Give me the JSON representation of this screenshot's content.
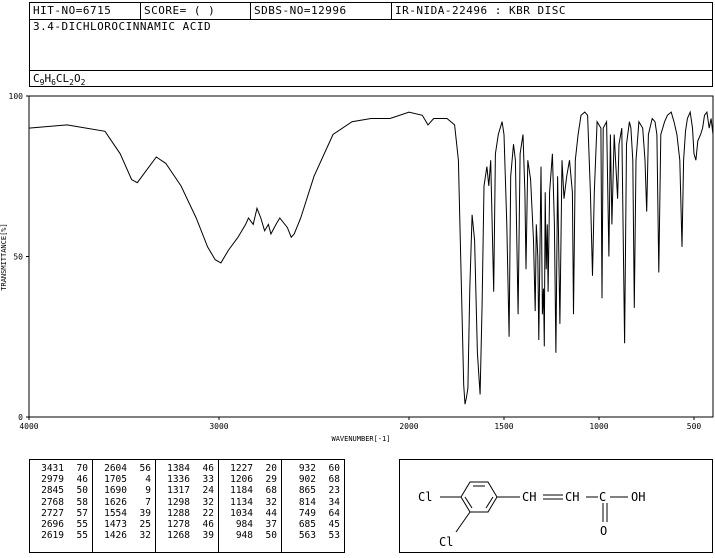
{
  "header": {
    "hit_no": "HIT-NO=6715",
    "score": "SCORE=  (   )",
    "sdbs_no": "SDBS-NO=12996",
    "ir_method": "IR-NIDA-22496 : KBR DISC",
    "compound_name": "3.4-DICHLOROCINNAMIC ACID",
    "formula_parts": [
      "C",
      "9",
      "H",
      "6",
      "CL",
      "2",
      "O",
      "2"
    ]
  },
  "chart_data": {
    "type": "line",
    "title": "",
    "xlabel": "WAVENUMBER[-1]",
    "ylabel": "TRANSMITTANCE[%]",
    "xlim": [
      4000,
      400
    ],
    "ylim": [
      0,
      100
    ],
    "x_reversed": true,
    "x_ticks": [
      "4000",
      "3000",
      "2000",
      "1500",
      "1000",
      "500"
    ],
    "y_ticks": [
      "0",
      "50",
      "100"
    ],
    "grid": false,
    "series": [
      {
        "color": "#000000",
        "points": [
          [
            4000,
            90
          ],
          [
            3800,
            91
          ],
          [
            3600,
            89
          ],
          [
            3520,
            82
          ],
          [
            3460,
            74
          ],
          [
            3430,
            73
          ],
          [
            3380,
            77
          ],
          [
            3330,
            81
          ],
          [
            3280,
            79
          ],
          [
            3200,
            72
          ],
          [
            3120,
            62
          ],
          [
            3060,
            53
          ],
          [
            3020,
            49
          ],
          [
            2990,
            48
          ],
          [
            2950,
            52
          ],
          [
            2900,
            56
          ],
          [
            2860,
            60
          ],
          [
            2845,
            62
          ],
          [
            2820,
            60
          ],
          [
            2800,
            65
          ],
          [
            2780,
            62
          ],
          [
            2760,
            58
          ],
          [
            2740,
            60
          ],
          [
            2727,
            57
          ],
          [
            2700,
            60
          ],
          [
            2680,
            62
          ],
          [
            2640,
            59
          ],
          [
            2620,
            56
          ],
          [
            2604,
            57
          ],
          [
            2570,
            62
          ],
          [
            2500,
            75
          ],
          [
            2400,
            88
          ],
          [
            2300,
            92
          ],
          [
            2200,
            93
          ],
          [
            2100,
            93
          ],
          [
            2000,
            95
          ],
          [
            1930,
            94
          ],
          [
            1900,
            91
          ],
          [
            1870,
            93
          ],
          [
            1800,
            93
          ],
          [
            1760,
            91
          ],
          [
            1740,
            80
          ],
          [
            1720,
            30
          ],
          [
            1712,
            10
          ],
          [
            1705,
            4
          ],
          [
            1698,
            6
          ],
          [
            1690,
            9
          ],
          [
            1680,
            40
          ],
          [
            1668,
            63
          ],
          [
            1655,
            55
          ],
          [
            1640,
            20
          ],
          [
            1626,
            7
          ],
          [
            1615,
            35
          ],
          [
            1605,
            72
          ],
          [
            1590,
            78
          ],
          [
            1580,
            72
          ],
          [
            1570,
            80
          ],
          [
            1554,
            39
          ],
          [
            1545,
            82
          ],
          [
            1530,
            88
          ],
          [
            1510,
            92
          ],
          [
            1500,
            88
          ],
          [
            1485,
            60
          ],
          [
            1473,
            25
          ],
          [
            1465,
            75
          ],
          [
            1450,
            85
          ],
          [
            1440,
            80
          ],
          [
            1426,
            32
          ],
          [
            1415,
            82
          ],
          [
            1400,
            88
          ],
          [
            1390,
            70
          ],
          [
            1384,
            46
          ],
          [
            1375,
            80
          ],
          [
            1360,
            74
          ],
          [
            1345,
            55
          ],
          [
            1336,
            33
          ],
          [
            1330,
            60
          ],
          [
            1322,
            50
          ],
          [
            1317,
            24
          ],
          [
            1305,
            78
          ],
          [
            1298,
            32
          ],
          [
            1292,
            40
          ],
          [
            1288,
            22
          ],
          [
            1283,
            70
          ],
          [
            1278,
            46
          ],
          [
            1272,
            60
          ],
          [
            1268,
            39
          ],
          [
            1260,
            70
          ],
          [
            1245,
            82
          ],
          [
            1235,
            60
          ],
          [
            1227,
            20
          ],
          [
            1218,
            75
          ],
          [
            1206,
            29
          ],
          [
            1195,
            80
          ],
          [
            1184,
            68
          ],
          [
            1170,
            75
          ],
          [
            1155,
            80
          ],
          [
            1140,
            70
          ],
          [
            1134,
            32
          ],
          [
            1125,
            80
          ],
          [
            1110,
            88
          ],
          [
            1095,
            94
          ],
          [
            1075,
            95
          ],
          [
            1060,
            94
          ],
          [
            1045,
            70
          ],
          [
            1034,
            44
          ],
          [
            1025,
            70
          ],
          [
            1010,
            92
          ],
          [
            990,
            90
          ],
          [
            984,
            37
          ],
          [
            978,
            90
          ],
          [
            960,
            92
          ],
          [
            948,
            50
          ],
          [
            940,
            88
          ],
          [
            932,
            60
          ],
          [
            920,
            88
          ],
          [
            902,
            68
          ],
          [
            895,
            85
          ],
          [
            880,
            90
          ],
          [
            865,
            23
          ],
          [
            855,
            85
          ],
          [
            840,
            92
          ],
          [
            832,
            90
          ],
          [
            822,
            80
          ],
          [
            814,
            34
          ],
          [
            805,
            80
          ],
          [
            790,
            92
          ],
          [
            770,
            90
          ],
          [
            758,
            80
          ],
          [
            749,
            64
          ],
          [
            740,
            88
          ],
          [
            720,
            93
          ],
          [
            705,
            92
          ],
          [
            695,
            88
          ],
          [
            685,
            45
          ],
          [
            675,
            88
          ],
          [
            655,
            92
          ],
          [
            640,
            94
          ],
          [
            620,
            95
          ],
          [
            605,
            92
          ],
          [
            590,
            88
          ],
          [
            575,
            80
          ],
          [
            563,
            53
          ],
          [
            555,
            80
          ],
          [
            545,
            89
          ],
          [
            535,
            93
          ],
          [
            520,
            95
          ],
          [
            508,
            90
          ],
          [
            500,
            82
          ],
          [
            490,
            80
          ],
          [
            480,
            86
          ],
          [
            465,
            88
          ],
          [
            455,
            90
          ],
          [
            445,
            94
          ],
          [
            432,
            95
          ],
          [
            420,
            90
          ],
          [
            410,
            93
          ],
          [
            400,
            88
          ]
        ]
      }
    ]
  },
  "peak_table": {
    "columns": [
      [
        [
          "3431",
          "70"
        ],
        [
          "2979",
          "46"
        ],
        [
          "2845",
          "50"
        ],
        [
          "2768",
          "58"
        ],
        [
          "2727",
          "57"
        ],
        [
          "2696",
          "55"
        ],
        [
          "2619",
          "55"
        ]
      ],
      [
        [
          "2604",
          "56"
        ],
        [
          "1705",
          "4"
        ],
        [
          "1690",
          "9"
        ],
        [
          "1626",
          "7"
        ],
        [
          "1554",
          "39"
        ],
        [
          "1473",
          "25"
        ],
        [
          "1426",
          "32"
        ]
      ],
      [
        [
          "1384",
          "46"
        ],
        [
          "1336",
          "33"
        ],
        [
          "1317",
          "24"
        ],
        [
          "1298",
          "32"
        ],
        [
          "1288",
          "22"
        ],
        [
          "1278",
          "46"
        ],
        [
          "1268",
          "39"
        ]
      ],
      [
        [
          "1227",
          "20"
        ],
        [
          "1206",
          "29"
        ],
        [
          "1184",
          "68"
        ],
        [
          "1134",
          "32"
        ],
        [
          "1034",
          "44"
        ],
        [
          "984",
          "37"
        ],
        [
          "948",
          "50"
        ]
      ],
      [
        [
          "932",
          "60"
        ],
        [
          "902",
          "68"
        ],
        [
          "865",
          "23"
        ],
        [
          "814",
          "34"
        ],
        [
          "749",
          "64"
        ],
        [
          "685",
          "45"
        ],
        [
          "563",
          "53"
        ]
      ]
    ]
  },
  "structure": {
    "label_cl_top": "Cl",
    "label_cl_bottom": "Cl",
    "label_oh": "OH",
    "label_o": "O",
    "label_ch1": "CH",
    "label_ch2": "CH",
    "label_c": "C"
  }
}
